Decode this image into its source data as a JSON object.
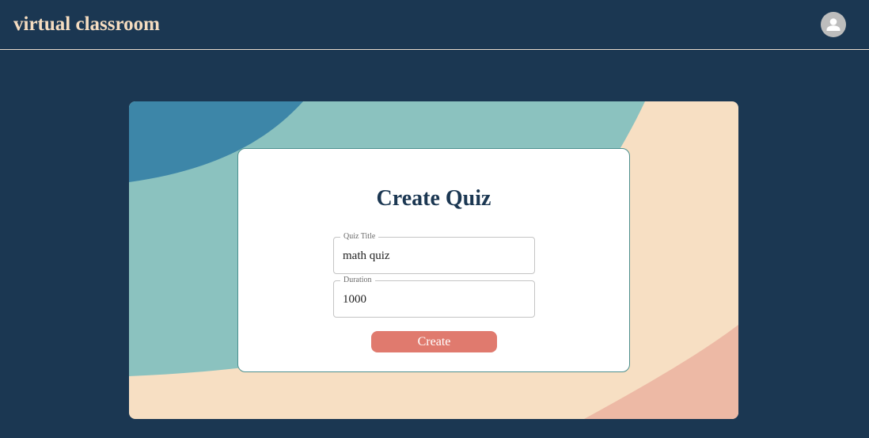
{
  "header": {
    "app_title": "virtual classroom",
    "avatar_icon": "user-avatar-icon"
  },
  "colors": {
    "navy": "#1b3752",
    "teal": "#8bc2bf",
    "blue": "#3d86a8",
    "peach": "#f7dfc3",
    "salmon": "#edb9a5",
    "button": "#e07a6e",
    "title_text": "#f5dcc0"
  },
  "form": {
    "title": "Create Quiz",
    "quiz_title_label": "Quiz Title",
    "quiz_title_value": "math quiz",
    "duration_label": "Duration",
    "duration_value": "1000",
    "submit_label": "Create"
  }
}
